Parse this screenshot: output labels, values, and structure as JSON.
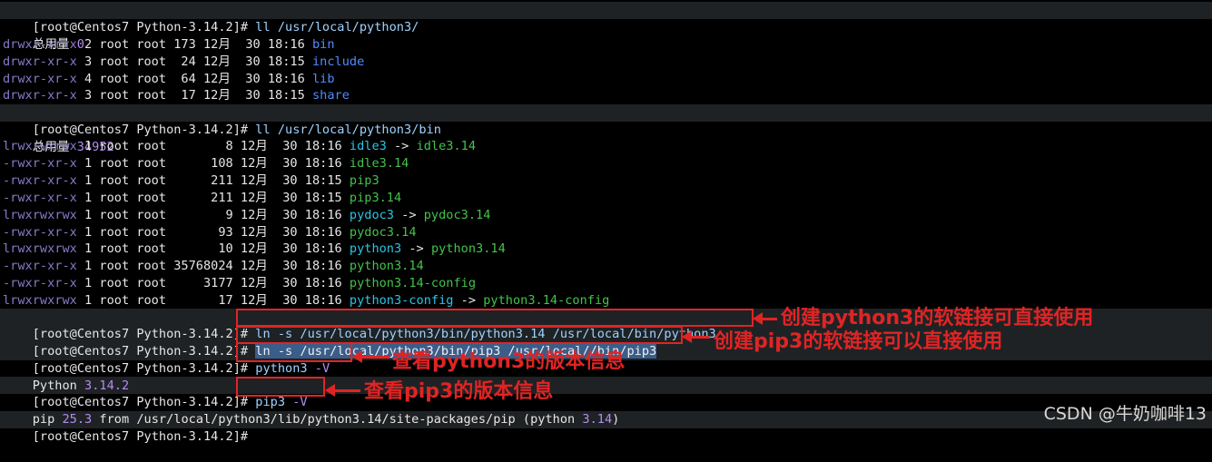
{
  "colors": {
    "background": "#000000",
    "directory": "#4f8cff",
    "executable": "#44c24a",
    "symlink": "#29c5e6",
    "annotation": "#e02424"
  },
  "terminal": {
    "cmd1": {
      "prompt": "[root@Centos7 Python-3.14.2]#",
      "command": " ll /usr/local/python3/"
    },
    "total1": {
      "label": "总用量 ",
      "value": "0"
    },
    "listing1": [
      {
        "perm": "drwxr-xr-x",
        "meta_pre": " 2 root root ",
        "size": "173",
        "meta_post": " 12月  30 18:16 ",
        "name": "bin"
      },
      {
        "perm": "drwxr-xr-x",
        "meta_pre": " 3 root root  ",
        "size": "24",
        "meta_post": " 12月  30 18:15 ",
        "name": "include"
      },
      {
        "perm": "drwxr-xr-x",
        "meta_pre": " 4 root root  ",
        "size": "64",
        "meta_post": " 12月  30 18:16 ",
        "name": "lib"
      },
      {
        "perm": "drwxr-xr-x",
        "meta_pre": " 3 root root  ",
        "size": "17",
        "meta_post": " 12月  30 18:15 ",
        "name": "share"
      }
    ],
    "cmd2": {
      "prompt": "[root@Centos7 Python-3.14.2]#",
      "command": " ll /usr/local/python3/bin"
    },
    "total2": {
      "label": "总用量 ",
      "value": "34952"
    },
    "listing2": [
      {
        "perm": "lrwxrwxrwx",
        "meta": " 1 root root        8 12月  30 18:16 ",
        "name": "idle3",
        "arrow": " -> ",
        "target": "idle3.14"
      },
      {
        "perm": "-rwxr-xr-x",
        "meta": " 1 root root      108 12月  30 18:16 ",
        "name": "idle3.14"
      },
      {
        "perm": "-rwxr-xr-x",
        "meta": " 1 root root      211 12月  30 18:15 ",
        "name": "pip3"
      },
      {
        "perm": "-rwxr-xr-x",
        "meta": " 1 root root      211 12月  30 18:15 ",
        "name": "pip3.14"
      },
      {
        "perm": "lrwxrwxrwx",
        "meta": " 1 root root        9 12月  30 18:16 ",
        "name": "pydoc3",
        "arrow": " -> ",
        "target": "pydoc3.14"
      },
      {
        "perm": "-rwxr-xr-x",
        "meta": " 1 root root       93 12月  30 18:16 ",
        "name": "pydoc3.14"
      },
      {
        "perm": "lrwxrwxrwx",
        "meta": " 1 root root       10 12月  30 18:16 ",
        "name": "python3",
        "arrow": " -> ",
        "target": "python3.14"
      },
      {
        "perm": "-rwxr-xr-x",
        "meta": " 1 root root 35768024 12月  30 18:16 ",
        "name": "python3.14"
      },
      {
        "perm": "-rwxr-xr-x",
        "meta": " 1 root root     3177 12月  30 18:16 ",
        "name": "python3.14-config"
      },
      {
        "perm": "lrwxrwxrwx",
        "meta": " 1 root root       17 12月  30 18:16 ",
        "name": "python3-config",
        "arrow": " -> ",
        "target": "python3.14-config"
      }
    ],
    "cmd3": {
      "prompt": "[root@Centos7 Python-3.14.2]#",
      "command": "ln -s /usr/local/python3/bin/python3.14 /usr/local/bin/python3"
    },
    "cmd4": {
      "prompt": "[root@Centos7 Python-3.14.2]#",
      "command": "ln -s /usr/local/python3/bin/pip3 /usr/local//bin/pip3"
    },
    "cmd5": {
      "prompt": "[root@Centos7 Python-3.14.2]#",
      "command": "python3 ",
      "flag": "-V"
    },
    "out5": {
      "text": "Python ",
      "version": "3.14.2"
    },
    "cmd6": {
      "prompt": "[root@Centos7 Python-3.14.2]#",
      "command": "pip3 ",
      "flag": "-V"
    },
    "out6": {
      "p1": "pip ",
      "v1": "25.3",
      "p2": " from /usr/local/python3/lib/python3.14/site-packages/pip (python ",
      "v2": "3.14",
      "p3": ")"
    },
    "cmd7": {
      "prompt": "[root@Centos7 Python-3.14.2]#"
    }
  },
  "annotations": {
    "note1": "创建python3的软链接可直接使用",
    "note2": "创建pip3的软链接可以直接使用",
    "note3": "查看python3的版本信息",
    "note4": "查看pip3的版本信息"
  },
  "watermark": "CSDN @牛奶咖啡13"
}
